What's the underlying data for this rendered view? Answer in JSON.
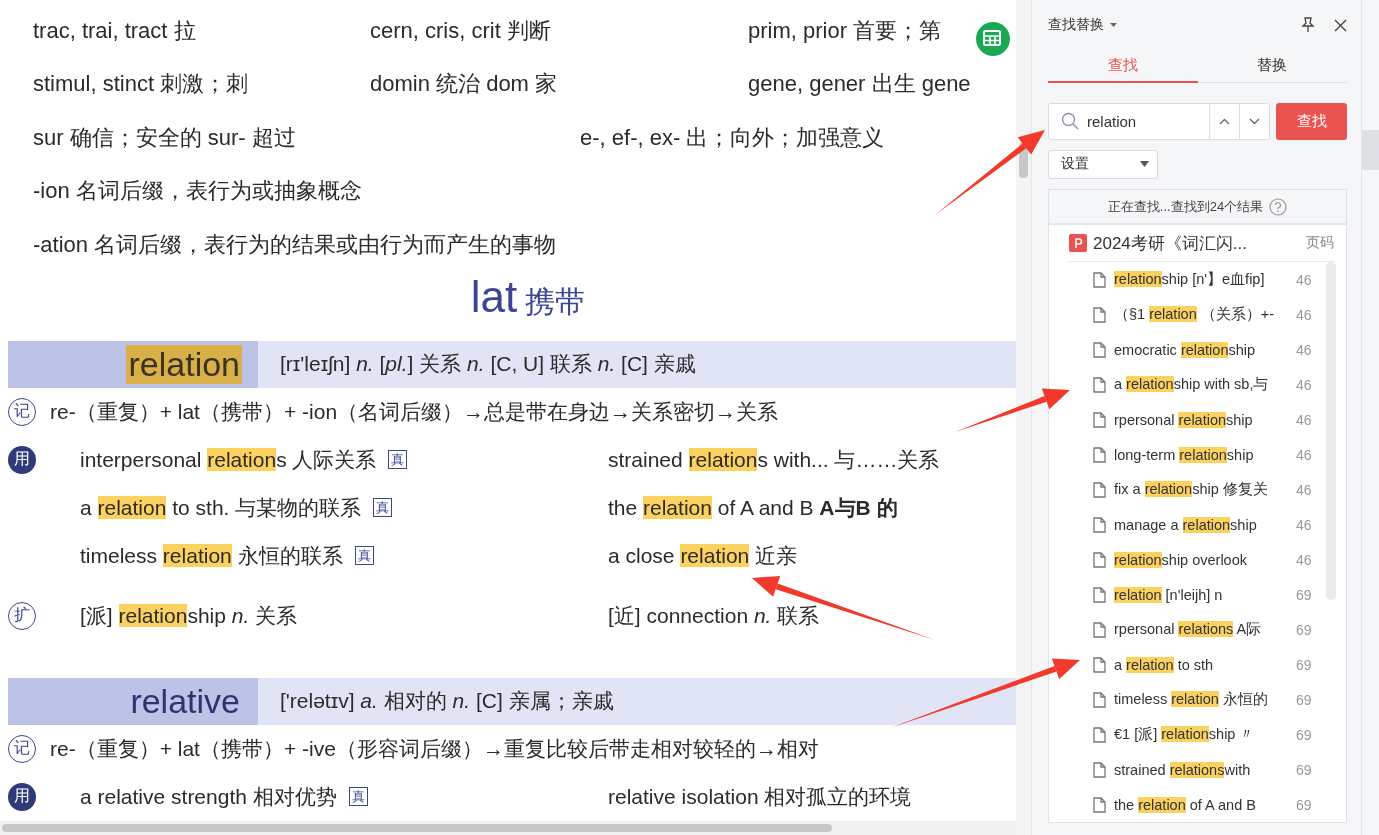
{
  "document": {
    "root_rows": [
      [
        "trac, trai, tract 拉",
        "cern, cris, crit 判断",
        "prim, prior 首要；第"
      ],
      [
        "stimul, stinct 刺激；刺",
        "domin 统治 dom 家",
        "gene, gener 出生 gene"
      ],
      [
        "sur 确信；安全的 sur- 超过",
        "e-, ef-, ex- 出；向外；加强意义"
      ]
    ],
    "suffix_lines": [
      "-ion 名词后缀，表行为或抽象概念",
      "-ation 名词后缀，表行为的结果或由行为而产生的事物"
    ],
    "heading": {
      "root": "lat",
      "meaning": "携带"
    },
    "entries": [
      {
        "word": "relation",
        "highlighted": true,
        "definition": "[rɪ'leɪʃn] *n.* [*pl.*] 关系 *n.* [C, U] 联系 *n.* [C] 亲戚",
        "sections": [
          {
            "kind": "memo",
            "marker": "记",
            "items": [
              {
                "segments": [
                  {
                    "text": "re-（重复）+ lat（携带）+ -ion（名词后缀）→总是带在身边→关系密切→关系",
                    "highlighted": false
                  }
                ]
              }
            ]
          },
          {
            "kind": "usage",
            "marker": "用",
            "items": [
              {
                "segments": [
                  {
                    "text": "interpersonal ",
                    "highlighted": false
                  },
                  {
                    "text": "relation",
                    "highlighted": true
                  },
                  {
                    "text": "s 人际关系",
                    "highlighted": false
                  }
                ],
                "badge": "真"
              },
              {
                "segments": [
                  {
                    "text": "strained ",
                    "highlighted": false
                  },
                  {
                    "text": "relation",
                    "highlighted": true
                  },
                  {
                    "text": "s with... 与……关系",
                    "highlighted": false
                  }
                ]
              },
              {
                "segments": [
                  {
                    "text": "a ",
                    "highlighted": false
                  },
                  {
                    "text": "relation",
                    "highlighted": true
                  },
                  {
                    "text": " to sth. 与某物的联系",
                    "highlighted": false
                  }
                ],
                "badge": "真"
              },
              {
                "segments": [
                  {
                    "text": "the ",
                    "highlighted": false
                  },
                  {
                    "text": "relation",
                    "highlighted": true
                  },
                  {
                    "text": " of A and B  **A与B 的**",
                    "highlighted": false
                  }
                ]
              },
              {
                "segments": [
                  {
                    "text": "timeless ",
                    "highlighted": false
                  },
                  {
                    "text": "relation",
                    "highlighted": true
                  },
                  {
                    "text": " 永恒的联系",
                    "highlighted": false
                  }
                ],
                "badge": "真"
              },
              {
                "segments": [
                  {
                    "text": "a close ",
                    "highlighted": false
                  },
                  {
                    "text": "relation",
                    "highlighted": true
                  },
                  {
                    "text": " 近亲",
                    "highlighted": false
                  }
                ]
              }
            ]
          },
          {
            "kind": "extend",
            "marker": "扩",
            "items": [
              {
                "segments": [
                  {
                    "text": "[派] ",
                    "highlighted": false
                  },
                  {
                    "text": "relation",
                    "highlighted": true
                  },
                  {
                    "text": "ship *n.* 关系",
                    "highlighted": false
                  }
                ]
              },
              {
                "segments": [
                  {
                    "text": "[近] connection *n.* 联系",
                    "highlighted": false
                  }
                ]
              }
            ]
          }
        ]
      },
      {
        "word": "relative",
        "highlighted": false,
        "definition": "['relətɪv] *a.* 相对的 *n.* [C] 亲属；亲戚",
        "sections": [
          {
            "kind": "memo",
            "marker": "记",
            "items": [
              {
                "segments": [
                  {
                    "text": "re-（重复）+ lat（携带）+ -ive（形容词后缀）→重复比较后带走相对较轻的→相对",
                    "highlighted": false
                  }
                ]
              }
            ]
          },
          {
            "kind": "usage",
            "marker": "用",
            "items": [
              {
                "segments": [
                  {
                    "text": "a relative strength 相对优势",
                    "highlighted": false
                  }
                ],
                "badge": "真"
              },
              {
                "segments": [
                  {
                    "text": "relative isolation 相对孤立的环境",
                    "highlighted": false
                  }
                ]
              }
            ]
          }
        ]
      }
    ]
  },
  "panel": {
    "title": "查找替换",
    "tabs": [
      {
        "label": "查找",
        "selected": true
      },
      {
        "label": "替换",
        "selected": false
      }
    ],
    "search": {
      "value": "relation",
      "button": "查找"
    },
    "settings": "设置",
    "status": "正在查找...查找到24个结果",
    "file": {
      "name": "2024考研《词汇闪...",
      "page_header": "页码"
    },
    "results": [
      {
        "segments": [
          {
            "text": "relation",
            "highlighted": true
          },
          {
            "text": "ship [n'】e血fip]",
            "highlighted": false
          }
        ],
        "page": "46"
      },
      {
        "segments": [
          {
            "text": " （§1 ",
            "highlighted": false
          },
          {
            "text": "relation",
            "highlighted": true
          },
          {
            "text": " （关系）+-",
            "highlighted": false
          }
        ],
        "page": "46"
      },
      {
        "segments": [
          {
            "text": "emocratic ",
            "highlighted": false
          },
          {
            "text": "relation",
            "highlighted": true
          },
          {
            "text": "ship",
            "highlighted": false
          }
        ],
        "page": "46"
      },
      {
        "segments": [
          {
            "text": "a ",
            "highlighted": false
          },
          {
            "text": "relation",
            "highlighted": true
          },
          {
            "text": "ship with sb,与",
            "highlighted": false
          }
        ],
        "page": "46"
      },
      {
        "segments": [
          {
            "text": "rpersonal ",
            "highlighted": false
          },
          {
            "text": "relation",
            "highlighted": true
          },
          {
            "text": "ship",
            "highlighted": false
          }
        ],
        "page": "46"
      },
      {
        "segments": [
          {
            "text": "long-term ",
            "highlighted": false
          },
          {
            "text": "relation",
            "highlighted": true
          },
          {
            "text": "ship",
            "highlighted": false
          }
        ],
        "page": "46"
      },
      {
        "segments": [
          {
            "text": "fix a ",
            "highlighted": false
          },
          {
            "text": "relation",
            "highlighted": true
          },
          {
            "text": "ship 修复关",
            "highlighted": false
          }
        ],
        "page": "46"
      },
      {
        "segments": [
          {
            "text": "manage a ",
            "highlighted": false
          },
          {
            "text": "relation",
            "highlighted": true
          },
          {
            "text": "ship",
            "highlighted": false
          }
        ],
        "page": "46"
      },
      {
        "segments": [
          {
            "text": "relation",
            "highlighted": true
          },
          {
            "text": "ship overlook",
            "highlighted": false
          }
        ],
        "page": "46"
      },
      {
        "segments": [
          {
            "text": "relation",
            "highlighted": true
          },
          {
            "text": "  [n'leijh]  n",
            "highlighted": false
          }
        ],
        "page": "69"
      },
      {
        "segments": [
          {
            "text": "rpersonal ",
            "highlighted": false
          },
          {
            "text": "relations",
            "highlighted": true
          },
          {
            "text": " A际",
            "highlighted": false
          }
        ],
        "page": "69"
      },
      {
        "segments": [
          {
            "text": "a ",
            "highlighted": false
          },
          {
            "text": "relation",
            "highlighted": true
          },
          {
            "text": " to sth",
            "highlighted": false
          }
        ],
        "page": "69"
      },
      {
        "segments": [
          {
            "text": "timeless ",
            "highlighted": false
          },
          {
            "text": "relation",
            "highlighted": true
          },
          {
            "text": " 永恒的",
            "highlighted": false
          }
        ],
        "page": "69"
      },
      {
        "segments": [
          {
            "text": "€1  [派]  ",
            "highlighted": false
          },
          {
            "text": "relation",
            "highlighted": true
          },
          {
            "text": "ship 〃",
            "highlighted": false
          }
        ],
        "page": "69"
      },
      {
        "segments": [
          {
            "text": "strained ",
            "highlighted": false
          },
          {
            "text": "relations",
            "highlighted": true
          },
          {
            "text": "with",
            "highlighted": false
          }
        ],
        "page": "69"
      },
      {
        "segments": [
          {
            "text": "the ",
            "highlighted": false
          },
          {
            "text": "relation",
            "highlighted": true
          },
          {
            "text": " of A and B",
            "highlighted": false
          }
        ],
        "page": "69"
      }
    ]
  }
}
